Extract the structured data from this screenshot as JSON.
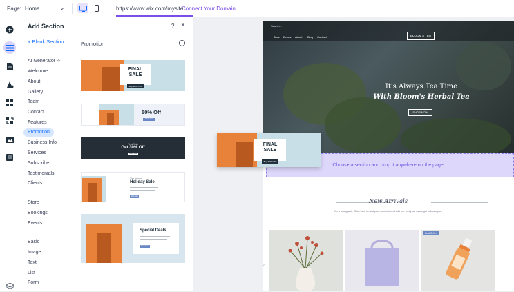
{
  "topbar": {
    "page_label": "Page:",
    "page_value": "Home",
    "url": "https://www.wix.com/mysite",
    "connect_domain": "Connect Your Domain"
  },
  "panel": {
    "title": "Add Section",
    "help": "?",
    "close": "×",
    "blank_section": "+  Blank Section",
    "selected_category": "Promotion",
    "categories": [
      "AI Generator",
      "Welcome",
      "About",
      "Gallery",
      "Team",
      "Contact",
      "Features",
      "Promotion",
      "Business Info",
      "Services",
      "Subscribe",
      "Testimonials",
      "Clients",
      "Store",
      "Bookings",
      "Events",
      "Basic",
      "Image",
      "Text",
      "List",
      "Form"
    ],
    "promotion_header": "Promotion",
    "info": "i",
    "cards": [
      {
        "title": "FINAL SALE",
        "sub": "Buy 30% OFF"
      },
      {
        "title": "50% Off",
        "button": "Shop Now"
      },
      {
        "title": "Get 30% Off",
        "sub": "Final Sale",
        "button": "Shop Now"
      },
      {
        "title": "Holiday Sale",
        "sub": "The Annual",
        "button": "Shop Now"
      },
      {
        "title": "Special Deals",
        "button": "Shop Now"
      }
    ]
  },
  "site": {
    "search": "Search...",
    "nav": [
      "Teas",
      "Extras",
      "About",
      "Blog",
      "Contact"
    ],
    "brand": "BLOOM'S TEA",
    "headline1": "It's Always Tea Time",
    "headline2": "With Bloom's Herbal Tea",
    "shop_now": "SHOP NOW",
    "drop_hint": "Choose a section and drop it anywhere on the page...",
    "new_arrivals": "New Arrivals",
    "new_arrivals_sub": "I'm a paragraph. Click here to add your own text and edit me. Let your users get to know you.",
    "best_seller": "Best Seller"
  },
  "drag_preview": {
    "title": "FINAL SALE",
    "sub": "Buy 30% OFF"
  },
  "colors": {
    "accent": "#7a4ee8",
    "link": "#116dff",
    "orange": "#e8813a",
    "drop_zone": "#ddd7fb"
  }
}
